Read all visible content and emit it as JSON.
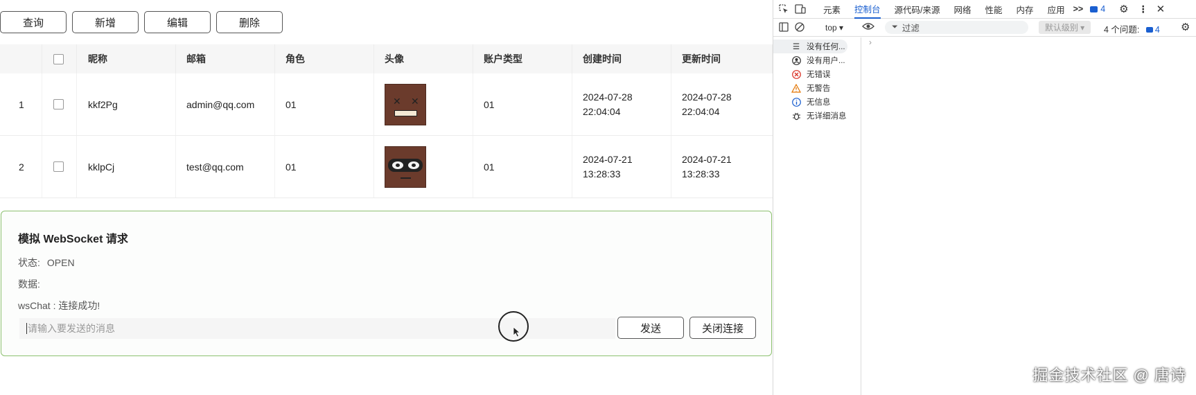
{
  "toolbar": {
    "query": "查询",
    "add": "新增",
    "edit": "编辑",
    "delete": "删除"
  },
  "table": {
    "headers": {
      "nickname": "昵称",
      "email": "邮箱",
      "role": "角色",
      "avatar": "头像",
      "account_type": "账户类型",
      "created": "创建时间",
      "updated": "更新时间"
    },
    "rows": [
      {
        "index": "1",
        "nickname": "kkf2Pg",
        "email": "admin@qq.com",
        "role": "01",
        "account_type": "01",
        "created_date": "2024-07-28",
        "created_time": "22:04:04",
        "updated_date": "2024-07-28",
        "updated_time": "22:04:04"
      },
      {
        "index": "2",
        "nickname": "kklpCj",
        "email": "test@qq.com",
        "role": "01",
        "account_type": "01",
        "created_date": "2024-07-21",
        "created_time": "13:28:33",
        "updated_date": "2024-07-21",
        "updated_time": "13:28:33"
      }
    ]
  },
  "ws": {
    "title": "模拟 WebSocket 请求",
    "status_label": "状态:",
    "status_value": "OPEN",
    "data_label": "数据:",
    "message": "wsChat : 连接成功!",
    "input_placeholder": "请输入要发送的消息",
    "send": "发送",
    "close": "关闭连接"
  },
  "devtools": {
    "tabs": [
      "元素",
      "控制台",
      "源代码/来源",
      "网络",
      "性能",
      "内存",
      "应用"
    ],
    "active_tab": "控制台",
    "more": ">>",
    "badge_count": "4",
    "context": "top ▾",
    "filter_placeholder": "过滤",
    "levels": "默认级别 ▾",
    "issues_label": "4 个问题:",
    "issues_count": "4",
    "sidebar": [
      {
        "label": "没有任何...",
        "icon": "list-icon"
      },
      {
        "label": "没有用户...",
        "icon": "user-icon"
      },
      {
        "label": "无错误",
        "icon": "error-icon"
      },
      {
        "label": "无警告",
        "icon": "warning-icon"
      },
      {
        "label": "无信息",
        "icon": "info-icon"
      },
      {
        "label": "无详细消息",
        "icon": "bug-icon"
      }
    ],
    "console_caret": "›"
  },
  "watermark": "掘金技术社区 @ 唐诗",
  "colors": {
    "ws_border": "#8cc06f",
    "active_tab": "#1a5fd0",
    "avatar_bg": "#6b3b2c"
  }
}
